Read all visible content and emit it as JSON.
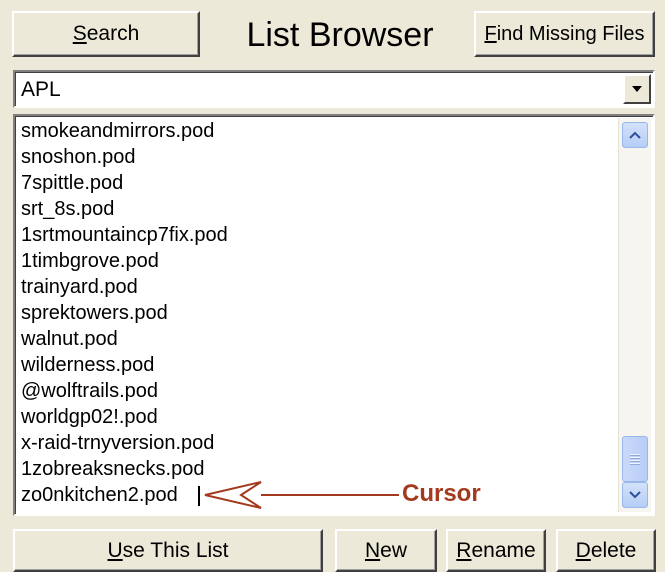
{
  "header": {
    "search_key": "S",
    "search_rest": "earch",
    "title": "List Browser",
    "find_key": "F",
    "find_rest": "ind Missing Files"
  },
  "combo": {
    "value": "APL"
  },
  "list": {
    "items": [
      "smokeandmirrors.pod",
      "snoshon.pod",
      "7spittle.pod",
      "srt_8s.pod",
      "1srtmountaincp7fix.pod",
      "1timbgrove.pod",
      "trainyard.pod",
      "sprektowers.pod",
      "walnut.pod",
      "wilderness.pod",
      "@wolftrails.pod",
      "worldgp02!.pod",
      "x-raid-trnyversion.pod",
      "1zobreaksnecks.pod",
      "zo0nkitchen2.pod"
    ]
  },
  "annotation": {
    "label": "Cursor",
    "color": "#a33a1e"
  },
  "footer": {
    "use_key": "U",
    "use_rest": "se This List",
    "new_key": "N",
    "new_rest": "ew",
    "rename_key": "R",
    "rename_rest": "ename",
    "delete_key": "D",
    "delete_rest": "elete"
  },
  "icons": {
    "combo_arrow": "chevron-down-icon",
    "scroll_up": "scroll-up-icon",
    "scroll_down": "scroll-down-icon"
  }
}
